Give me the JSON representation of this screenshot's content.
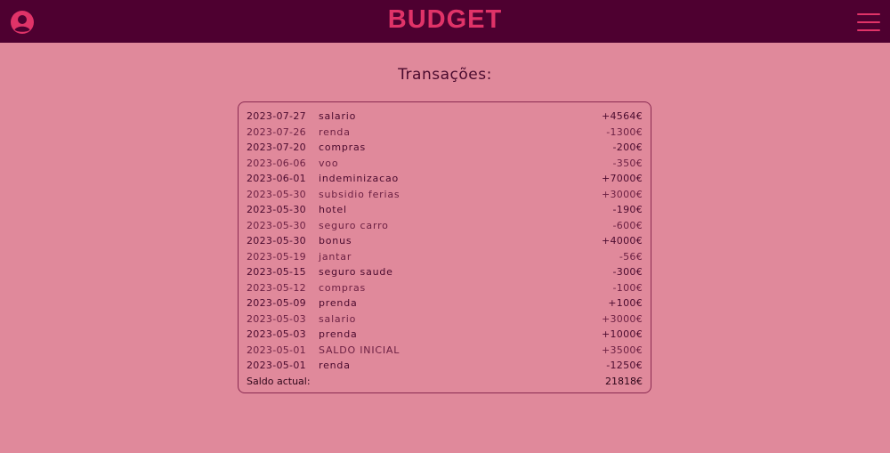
{
  "header": {
    "title": "BUDGET",
    "user_icon": "user-circle-icon",
    "menu_icon": "hamburger-menu-icon",
    "accent_color": "#e03368",
    "bar_color": "#4e0030"
  },
  "main": {
    "section_title": "Transações:",
    "transactions": [
      {
        "date": "2023-07-27",
        "description": "salario",
        "amount": "+4564€"
      },
      {
        "date": "2023-07-26",
        "description": "renda",
        "amount": "-1300€"
      },
      {
        "date": "2023-07-20",
        "description": "compras",
        "amount": "-200€"
      },
      {
        "date": "2023-06-06",
        "description": "voo",
        "amount": "-350€"
      },
      {
        "date": "2023-06-01",
        "description": "indeminizacao",
        "amount": "+7000€"
      },
      {
        "date": "2023-05-30",
        "description": "subsidio ferias",
        "amount": "+3000€"
      },
      {
        "date": "2023-05-30",
        "description": "hotel",
        "amount": "-190€"
      },
      {
        "date": "2023-05-30",
        "description": "seguro carro",
        "amount": "-600€"
      },
      {
        "date": "2023-05-30",
        "description": "bonus",
        "amount": "+4000€"
      },
      {
        "date": "2023-05-19",
        "description": "jantar",
        "amount": "-56€"
      },
      {
        "date": "2023-05-15",
        "description": "seguro saude",
        "amount": "-300€"
      },
      {
        "date": "2023-05-12",
        "description": "compras",
        "amount": "-100€"
      },
      {
        "date": "2023-05-09",
        "description": "prenda",
        "amount": "+100€"
      },
      {
        "date": "2023-05-03",
        "description": "salario",
        "amount": "+3000€"
      },
      {
        "date": "2023-05-03",
        "description": "prenda",
        "amount": "+1000€"
      },
      {
        "date": "2023-05-01",
        "description": "SALDO INICIAL",
        "amount": "+3500€"
      },
      {
        "date": "2023-05-01",
        "description": "renda",
        "amount": "-1250€"
      }
    ],
    "total_label": "Saldo actual:",
    "total_amount": "21818€"
  }
}
